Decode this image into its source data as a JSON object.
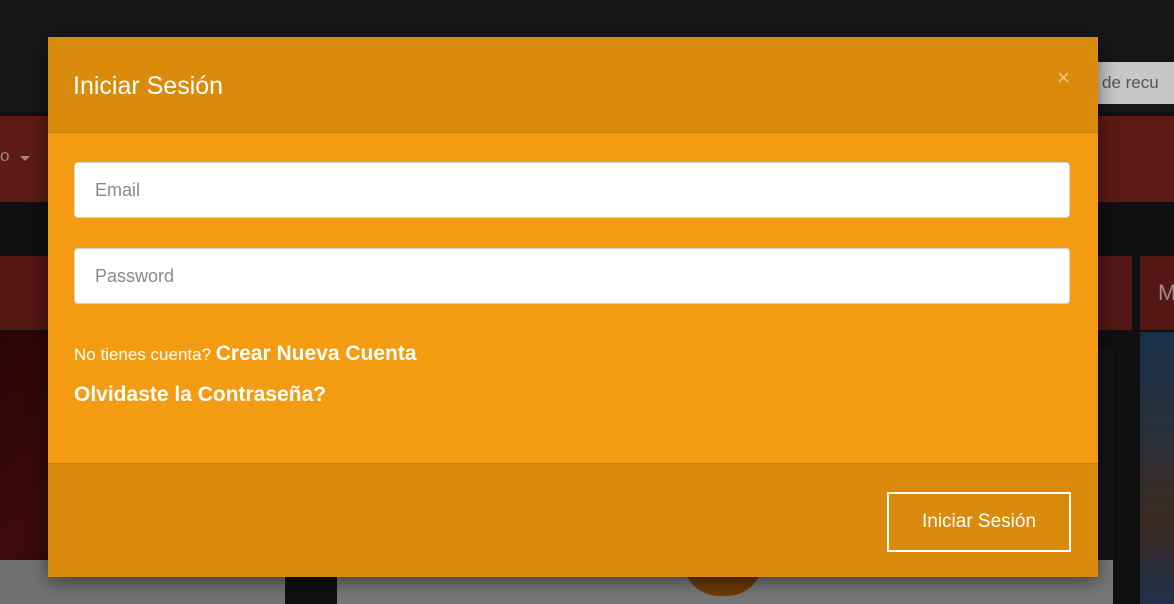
{
  "background": {
    "search_partial_text": "de recu",
    "nav_partial_text": "o",
    "tab_partial_text": "M"
  },
  "modal": {
    "title": "Iniciar Sesión",
    "close_glyph": "×",
    "email": {
      "value": "",
      "placeholder": "Email"
    },
    "password": {
      "value": "",
      "placeholder": "Password"
    },
    "no_account_text": "No tienes cuenta? ",
    "create_account_link": "Crear Nueva Cuenta",
    "forgot_password_link": "Olvidaste la Contraseña?",
    "submit_label": "Iniciar Sesión"
  },
  "colors": {
    "modal_body": "#f39c12",
    "modal_header_footer": "#db8b0b",
    "backdrop": "#0f1012"
  }
}
